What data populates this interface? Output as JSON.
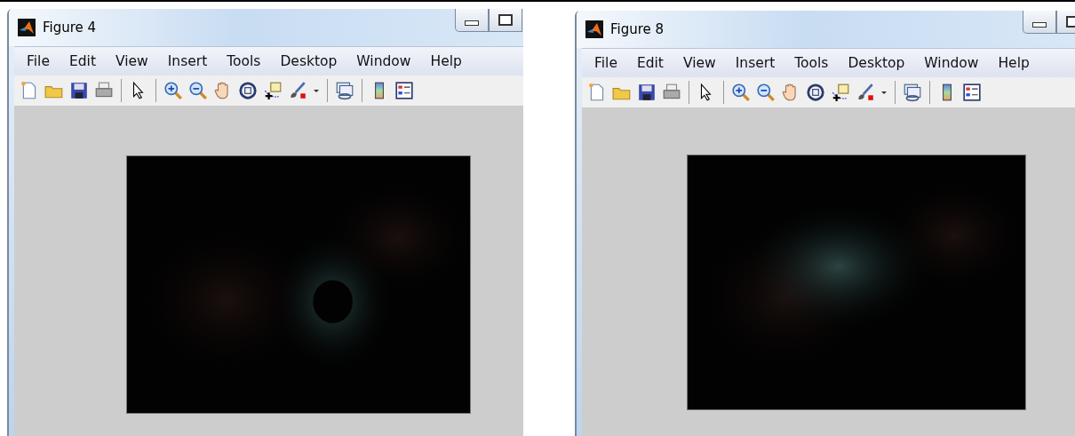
{
  "windows": [
    {
      "title": "Figure 4",
      "menu": [
        "File",
        "Edit",
        "View",
        "Insert",
        "Tools",
        "Desktop",
        "Window",
        "Help"
      ]
    },
    {
      "title": "Figure 8",
      "menu": [
        "File",
        "Edit",
        "View",
        "Insert",
        "Tools",
        "Desktop",
        "Window",
        "Help"
      ]
    }
  ]
}
